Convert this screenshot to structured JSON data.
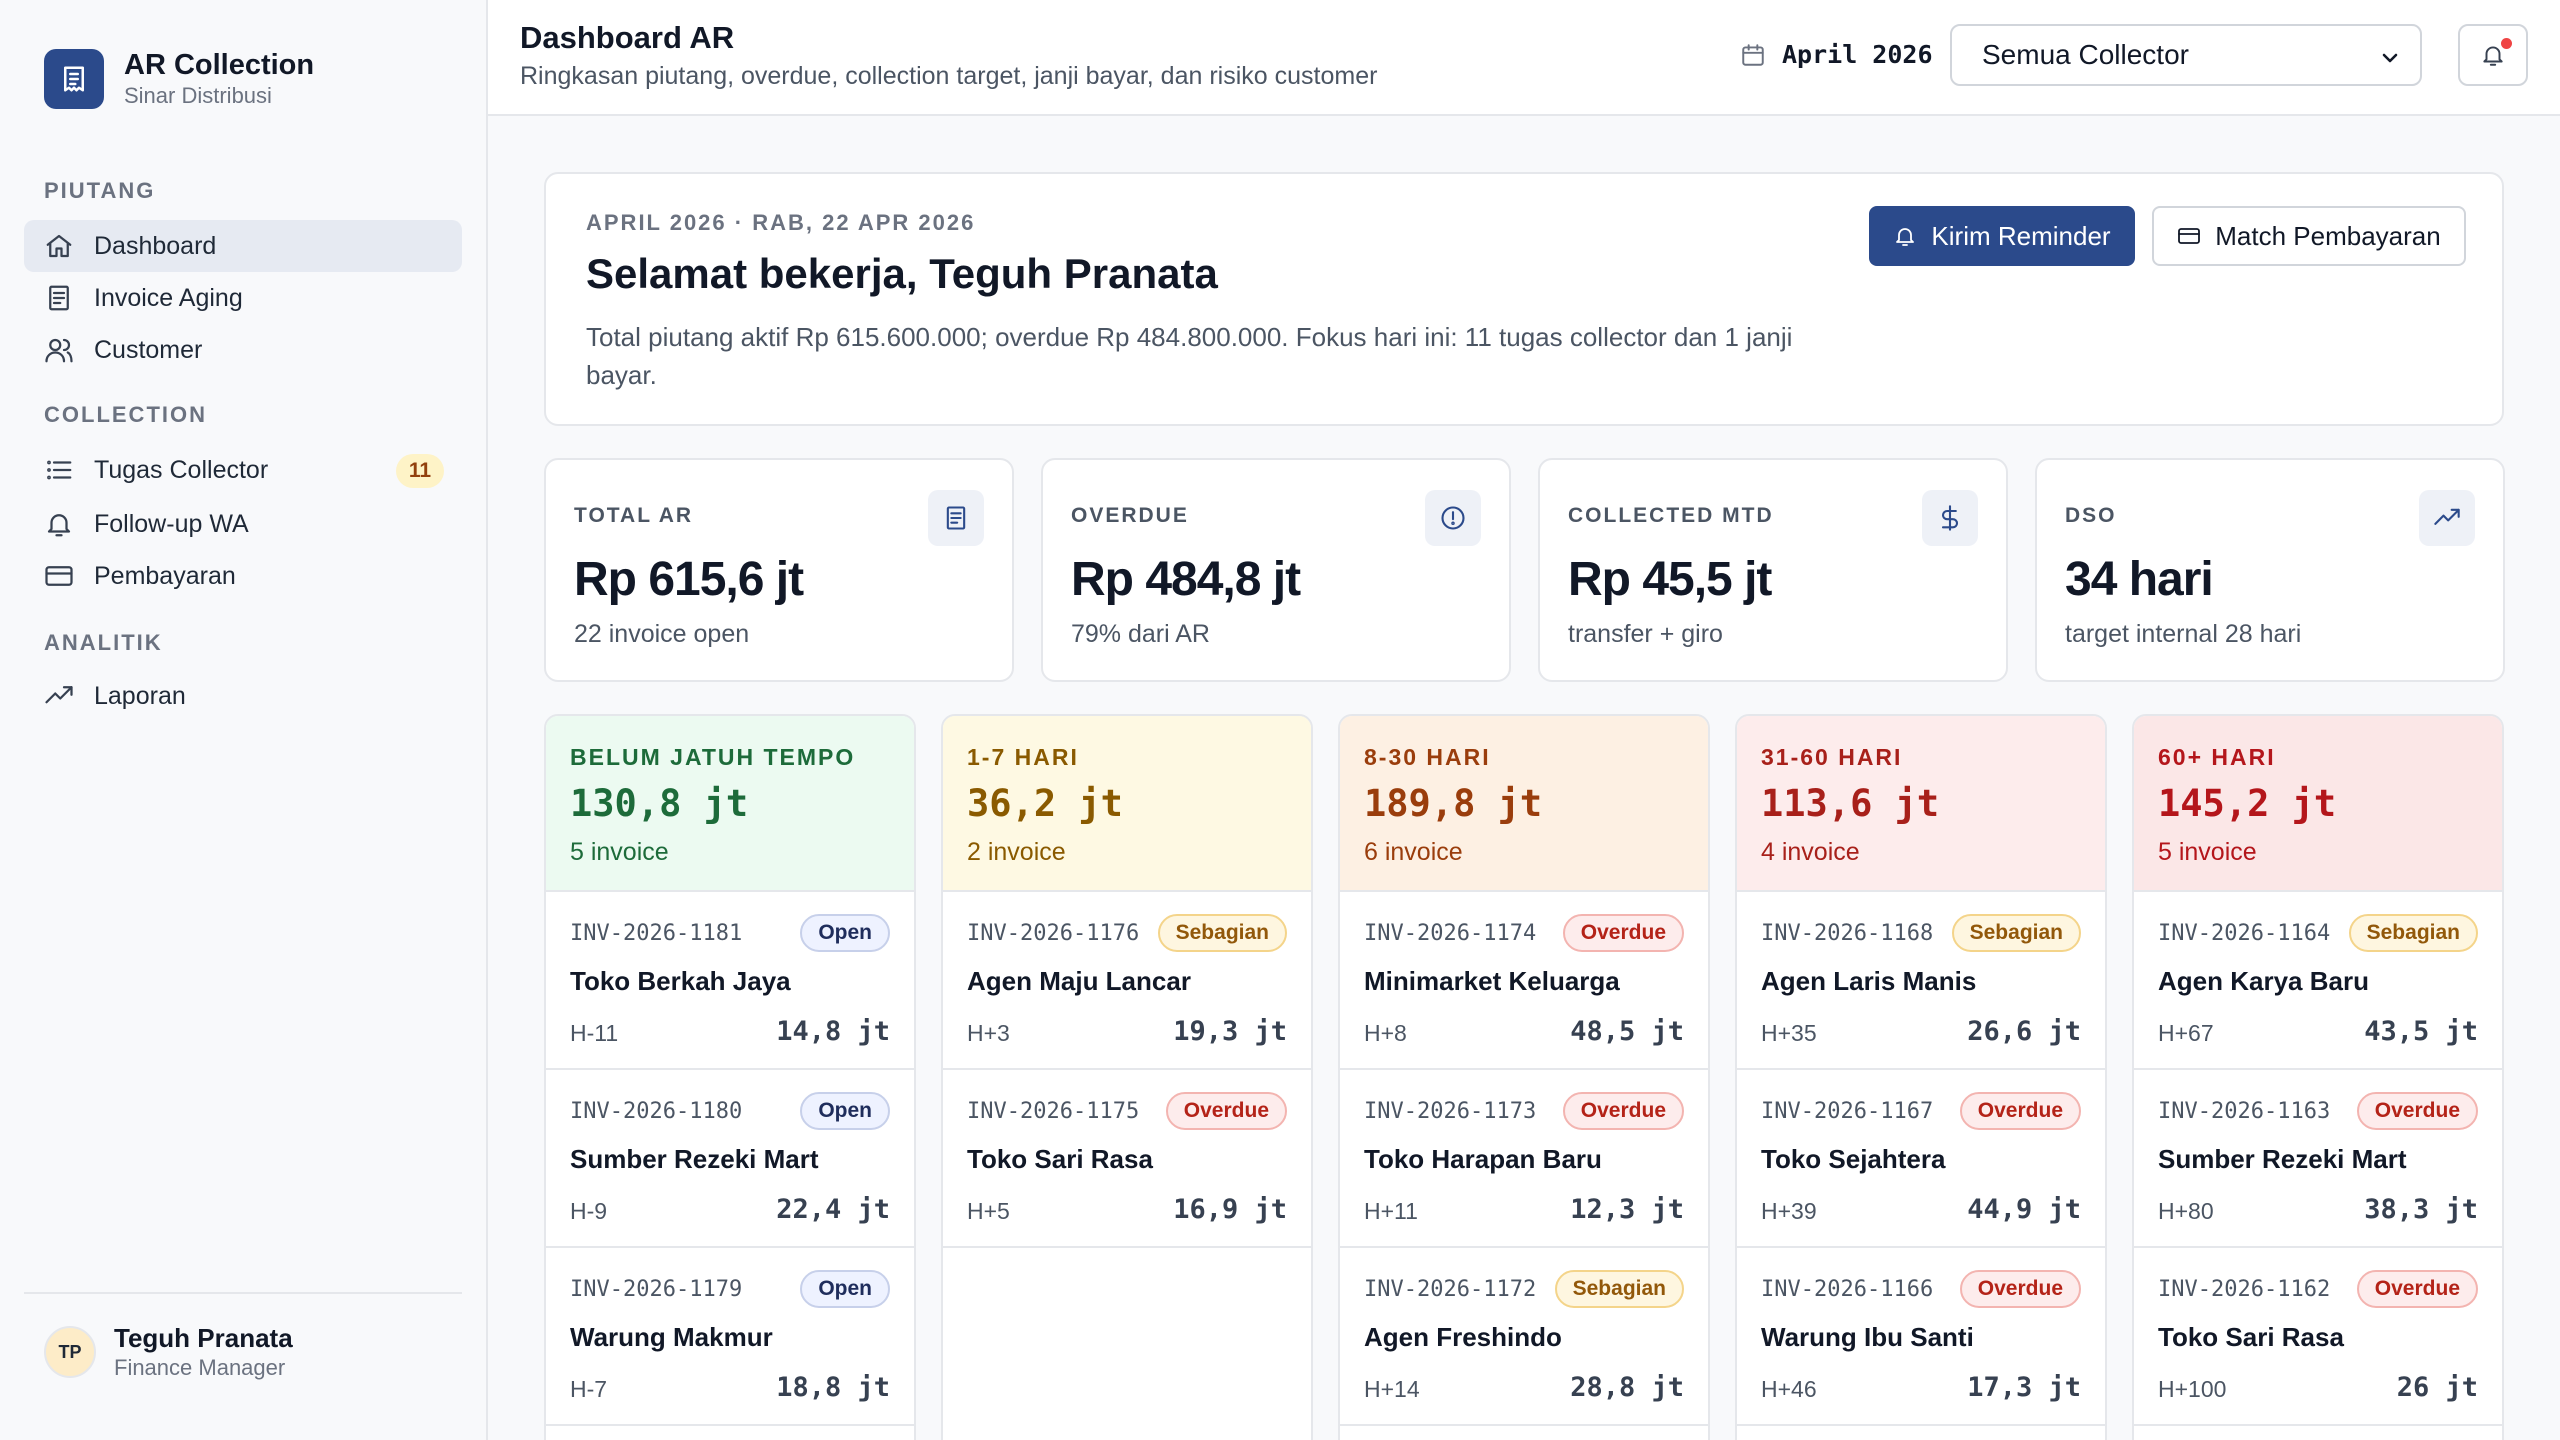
{
  "brand": {
    "title": "AR Collection",
    "subtitle": "Sinar Distribusi"
  },
  "nav": {
    "sections": [
      "PIUTANG",
      "COLLECTION",
      "ANALITIK"
    ],
    "items": [
      {
        "label": "Dashboard",
        "icon": "home-icon",
        "active": true
      },
      {
        "label": "Invoice Aging",
        "icon": "receipt-icon"
      },
      {
        "label": "Customer",
        "icon": "users-icon"
      },
      {
        "label": "Tugas Collector",
        "icon": "list-icon",
        "badge": "11"
      },
      {
        "label": "Follow-up WA",
        "icon": "bell-icon"
      },
      {
        "label": "Pembayaran",
        "icon": "card-icon"
      },
      {
        "label": "Laporan",
        "icon": "trend-icon"
      }
    ]
  },
  "user": {
    "initials": "TP",
    "name": "Teguh Pranata",
    "role": "Finance Manager"
  },
  "header": {
    "title": "Dashboard AR",
    "subtitle": "Ringkasan piutang, overdue, collection target, janji bayar, dan risiko customer",
    "period": "April 2026",
    "collector_selected": "Semua Collector"
  },
  "welcome": {
    "date": "APRIL 2026 · RAB, 22 APR 2026",
    "title": "Selamat bekerja, Teguh Pranata",
    "text": "Total piutang aktif Rp 615.600.000; overdue Rp 484.800.000. Fokus hari ini: 11 tugas collector dan 1 janji bayar.",
    "btn_reminder": "Kirim Reminder",
    "btn_match": "Match Pembayaran"
  },
  "kpis": [
    {
      "label": "TOTAL AR",
      "value": "Rp 615,6 jt",
      "sub": "22 invoice open",
      "icon": "receipt-icon"
    },
    {
      "label": "OVERDUE",
      "value": "Rp 484,8 jt",
      "sub": "79% dari AR",
      "icon": "alert-circle-icon"
    },
    {
      "label": "COLLECTED MTD",
      "value": "Rp 45,5 jt",
      "sub": "transfer + giro",
      "icon": "dollar-icon"
    },
    {
      "label": "DSO",
      "value": "34 hari",
      "sub": "target internal 28 hari",
      "icon": "trend-up-icon"
    }
  ],
  "colors": {
    "primary": "#2b4a8b",
    "bucket_green_bg": "#ecfaf1",
    "bucket_green_fg": "#1d6b3a",
    "bucket_yellow_bg": "#fef9e3",
    "bucket_yellow_fg": "#8a5a00",
    "bucket_orange_bg": "#fdf0e3",
    "bucket_orange_fg": "#9a3d0c",
    "bucket_red_bg": "#fdecec",
    "bucket_red_fg": "#a8201a",
    "bucket_red2_bg": "#fbe7e7",
    "bucket_red2_fg": "#b4161b"
  },
  "buckets": [
    {
      "title": "BELUM JATUH TEMPO",
      "amount": "130,8 jt",
      "count": "5 invoice",
      "invoices": [
        {
          "no": "INV-2026-1181",
          "status": "Open",
          "customer": "Toko Berkah Jaya",
          "due": "H-11",
          "amount": "14,8 jt"
        },
        {
          "no": "INV-2026-1180",
          "status": "Open",
          "customer": "Sumber Rezeki Mart",
          "due": "H-9",
          "amount": "22,4 jt"
        },
        {
          "no": "INV-2026-1179",
          "status": "Open",
          "customer": "Warung Makmur",
          "due": "H-7",
          "amount": "18,8 jt"
        }
      ]
    },
    {
      "title": "1-7 HARI",
      "amount": "36,2 jt",
      "count": "2 invoice",
      "invoices": [
        {
          "no": "INV-2026-1176",
          "status": "Sebagian",
          "customer": "Agen Maju Lancar",
          "due": "H+3",
          "amount": "19,3 jt"
        },
        {
          "no": "INV-2026-1175",
          "status": "Overdue",
          "customer": "Toko Sari Rasa",
          "due": "H+5",
          "amount": "16,9 jt"
        }
      ]
    },
    {
      "title": "8-30 HARI",
      "amount": "189,8 jt",
      "count": "6 invoice",
      "invoices": [
        {
          "no": "INV-2026-1174",
          "status": "Overdue",
          "customer": "Minimarket Keluarga",
          "due": "H+8",
          "amount": "48,5 jt"
        },
        {
          "no": "INV-2026-1173",
          "status": "Overdue",
          "customer": "Toko Harapan Baru",
          "due": "H+11",
          "amount": "12,3 jt"
        },
        {
          "no": "INV-2026-1172",
          "status": "Sebagian",
          "customer": "Agen Freshindo",
          "due": "H+14",
          "amount": "28,8 jt"
        }
      ]
    },
    {
      "title": "31-60 HARI",
      "amount": "113,6 jt",
      "count": "4 invoice",
      "invoices": [
        {
          "no": "INV-2026-1168",
          "status": "Sebagian",
          "customer": "Agen Laris Manis",
          "due": "H+35",
          "amount": "26,6 jt"
        },
        {
          "no": "INV-2026-1167",
          "status": "Overdue",
          "customer": "Toko Sejahtera",
          "due": "H+39",
          "amount": "44,9 jt"
        },
        {
          "no": "INV-2026-1166",
          "status": "Overdue",
          "customer": "Warung Ibu Santi",
          "due": "H+46",
          "amount": "17,3 jt"
        }
      ]
    },
    {
      "title": "60+ HARI",
      "amount": "145,2 jt",
      "count": "5 invoice",
      "invoices": [
        {
          "no": "INV-2026-1164",
          "status": "Sebagian",
          "customer": "Agen Karya Baru",
          "due": "H+67",
          "amount": "43,5 jt"
        },
        {
          "no": "INV-2026-1163",
          "status": "Overdue",
          "customer": "Sumber Rezeki Mart",
          "due": "H+80",
          "amount": "38,3 jt"
        },
        {
          "no": "INV-2026-1162",
          "status": "Overdue",
          "customer": "Toko Sari Rasa",
          "due": "H+100",
          "amount": "26 jt"
        }
      ]
    }
  ]
}
